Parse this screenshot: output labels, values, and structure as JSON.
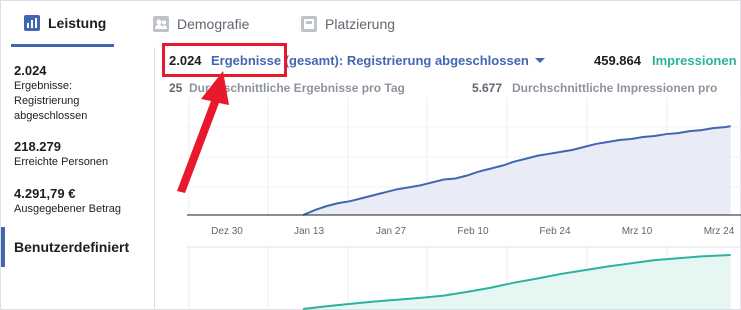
{
  "tabs": [
    {
      "label": "Leistung",
      "icon": "bar-chart-icon",
      "active": true
    },
    {
      "label": "Demografie",
      "icon": "people-icon",
      "active": false
    },
    {
      "label": "Platzierung",
      "icon": "placement-icon",
      "active": false
    }
  ],
  "sidebar": {
    "stats": [
      {
        "value": "2.024",
        "label": "Ergebnisse: Registrierung abgeschlossen"
      },
      {
        "value": "218.279",
        "label": "Erreichte Personen"
      },
      {
        "value": "4.291,79 €",
        "label": "Ausgegebener Betrag"
      }
    ],
    "custom_label": "Benutzerdefiniert"
  },
  "metrics": {
    "results_value": "2.024",
    "results_selector": "Ergebnisse (gesamt): Registrierung abgeschlossen",
    "impressions_value": "459.864",
    "impressions_label": "Impressionen",
    "avg_results_value": "25",
    "avg_results_label": "Durchschnittliche Ergebnisse pro Tag",
    "avg_impressions_value": "5.677",
    "avg_impressions_label": "Durchschnittliche Impressionen pro"
  },
  "colors": {
    "accent": "#4267b2",
    "teal": "#2bb39f",
    "highlight": "#e8192c"
  },
  "chart_data": [
    {
      "type": "area",
      "name": "results",
      "color": "#4267b2",
      "x_ticks": [
        "Dez 30",
        "Jan 13",
        "Jan 27",
        "Feb 10",
        "Feb 24",
        "Mrz 10",
        "Mrz 24"
      ],
      "x": [
        13,
        15,
        17,
        19,
        21,
        23,
        25,
        27,
        29,
        31,
        33,
        35,
        37,
        39,
        41,
        43,
        45,
        47,
        49,
        51,
        53,
        55,
        57,
        59,
        61,
        63,
        65,
        67,
        69,
        71,
        73,
        75,
        77,
        79,
        81,
        83,
        85,
        86
      ],
      "values": [
        0,
        5,
        9,
        12,
        14,
        17,
        20,
        23,
        26,
        28,
        30,
        33,
        36,
        37,
        40,
        44,
        47,
        50,
        54,
        57,
        60,
        62,
        64,
        66,
        69,
        72,
        74,
        76,
        77,
        79,
        80,
        82,
        83,
        85,
        86,
        88,
        89,
        90
      ],
      "ylim": [
        0,
        100
      ]
    },
    {
      "type": "area",
      "name": "impressions",
      "color": "#2bb39f",
      "x": [
        13,
        17,
        21,
        25,
        29,
        33,
        37,
        41,
        45,
        49,
        53,
        57,
        61,
        65,
        69,
        73,
        77,
        81,
        86
      ],
      "values": [
        0,
        6,
        11,
        16,
        20,
        24,
        29,
        37,
        46,
        57,
        66,
        76,
        84,
        92,
        99,
        106,
        110,
        114,
        117
      ],
      "ylim": [
        0,
        130
      ]
    }
  ]
}
